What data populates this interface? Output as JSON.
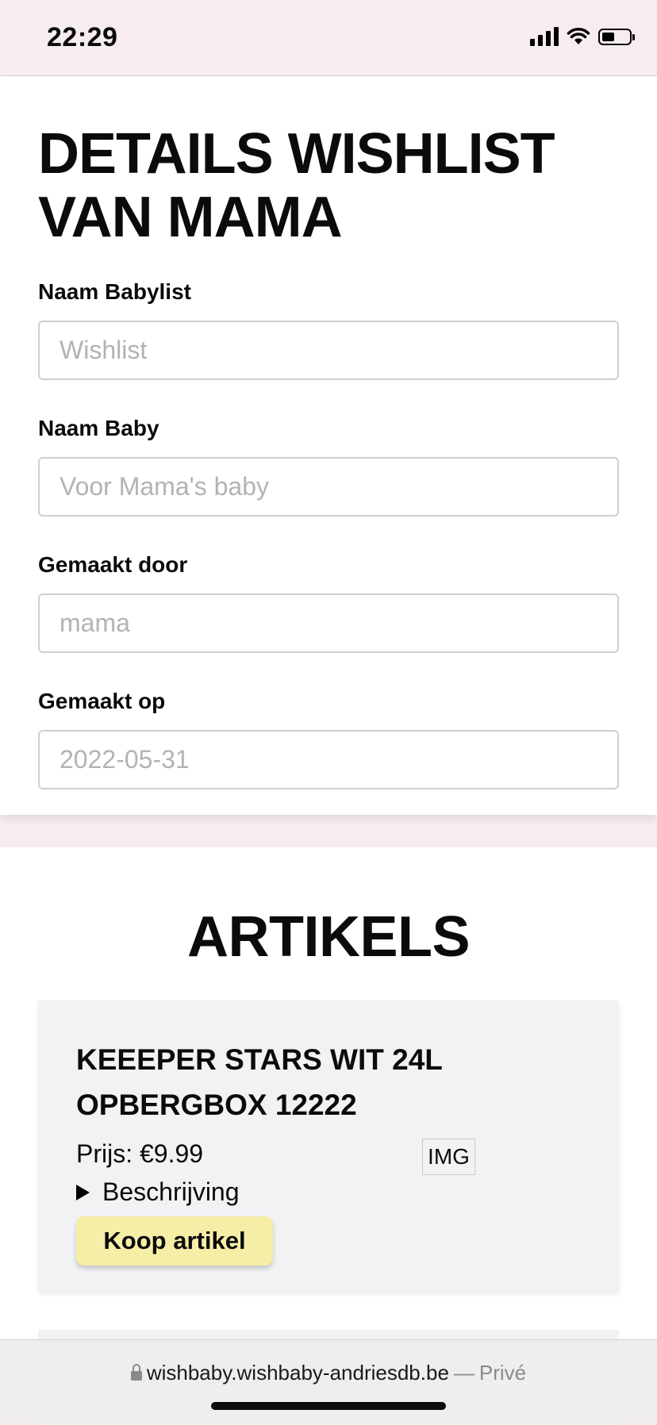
{
  "status_bar": {
    "time": "22:29",
    "icons": [
      "signal-icon",
      "wifi-icon",
      "battery-icon"
    ],
    "battery_level": 0.45
  },
  "details": {
    "title": "DETAILS WISHLIST VAN MAMA",
    "fields": [
      {
        "label": "Naam Babylist",
        "placeholder": "Wishlist"
      },
      {
        "label": "Naam Baby",
        "placeholder": "Voor Mama's baby"
      },
      {
        "label": "Gemaakt door",
        "placeholder": "mama"
      },
      {
        "label": "Gemaakt op",
        "placeholder": "2022-05-31"
      }
    ]
  },
  "articles": {
    "title": "ARTIKELS",
    "items": [
      {
        "name": "KEEEPER STARS WIT 24L OPBERGBOX 12222",
        "price": "Prijs: €9.99",
        "image_alt": "IMG",
        "description_label": "Beschrijving",
        "buy_label": "Koop artikel"
      }
    ]
  },
  "browser": {
    "domain": "wishbaby.wishbaby-andriesdb.be",
    "separator": "—",
    "mode": "Privé"
  },
  "colors": {
    "page_background": "#f7ecee",
    "card_background": "#f1f2f4",
    "buy_button": "#f6eda7"
  }
}
